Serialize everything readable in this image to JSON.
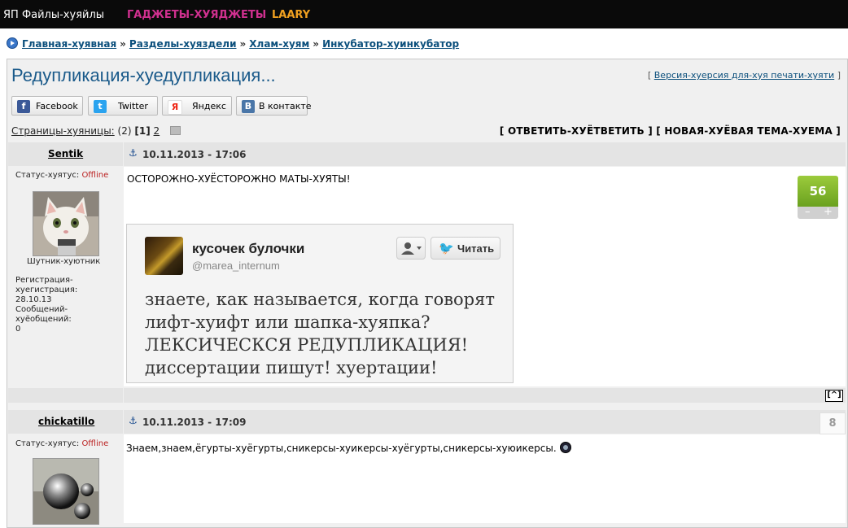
{
  "topnav": {
    "files": "ЯП Файлы-хуяйлы",
    "gadgets": "ГАДЖЕТЫ-ХУЯДЖЕТЫ",
    "laary": "LAARY"
  },
  "breadcrumb": {
    "items": [
      "Главная-хуявная",
      "Разделы-хуяздели",
      "Хлам-хуям",
      "Инкубатор-хуинкубатор"
    ],
    "separator": "»"
  },
  "topic": {
    "title": "Редупликация-хуедупликация...",
    "print_version": "Версия-хуерсия для-хуя печати-хуяти",
    "bracket_open": "[",
    "bracket_close": "]"
  },
  "share": {
    "facebook": "Facebook",
    "twitter": "Twitter",
    "yandex": "Яндекс",
    "vkontakte": "В контакте"
  },
  "pagination": {
    "label": "Страницы-хуяницы:",
    "total": "(2)",
    "current": "[1]",
    "next": "2"
  },
  "actions": {
    "reply": "[ ОТВЕТИТЬ-ХУЁТВЕТИТЬ ]",
    "new_topic": "[ НОВАЯ-ХУЁВАЯ ТЕМА-ХУЕМА ]"
  },
  "posts": [
    {
      "author": "Sentik",
      "date": "10.11.2013 - 17:06",
      "status_label": "Статус-хуятус:",
      "status_value": "Offline",
      "user_title": "Шутник-хуютник",
      "reg_label": "Регистрация-хуегистрация:",
      "reg_date": "28.10.13",
      "msg_label": "Сообщений-хуёобщений:",
      "msg_count": "0",
      "text": "ОСТОРОЖНО-ХУЁСТОРОЖНО МАТЫ-ХУЯТЫ!",
      "rating": "56",
      "rating_minus": "–",
      "rating_plus": "+"
    },
    {
      "author": "chickatillo",
      "date": "10.11.2013 - 17:09",
      "status_label": "Статус-хуятус:",
      "status_value": "Offline",
      "text": "Знаем,знаем,ёгурты-хуёгурты,сникерсы-хуикерсы-хуёгурты,сникерсы-хуюикерсы.",
      "rating": "8"
    }
  ],
  "tweet": {
    "name": "кусочек булочки",
    "handle": "@marea_internum",
    "follow": "Читать",
    "lines": [
      "знаете, как называется, когда говорят",
      "лифт-хуифт или шапка-хуяпка?",
      "ЛЕКСИЧЕСКСЯ РЕДУПЛИКАЦИЯ!",
      "диссертации пишут! хуертации!"
    ]
  },
  "top_link": "[^]",
  "colors": {
    "topbar_bg": "#0a0a0a",
    "gadgets": "#d0308f",
    "laary": "#f0a020",
    "link": "#0b4f7c",
    "title": "#1a5a8a",
    "offline": "#b22222",
    "rating_green": "#7db12a",
    "twitter_blue": "#2aa3ef"
  },
  "icons": [
    "home-icon",
    "facebook-icon",
    "twitter-icon",
    "yandex-icon",
    "vk-icon",
    "anchor-icon",
    "user-icon",
    "bird-icon",
    "smile-icon"
  ]
}
